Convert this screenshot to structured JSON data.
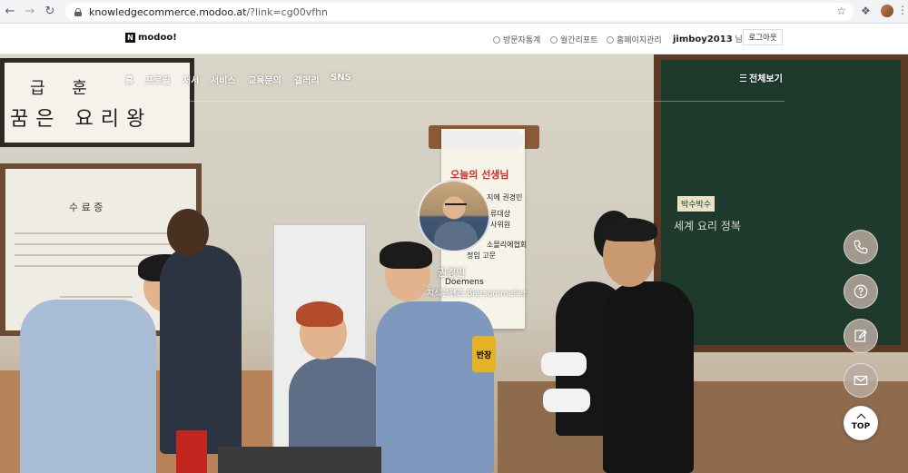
{
  "browser": {
    "url_domain": "knowledgecommerce.modoo.at",
    "url_path": "/?link=cg00vfhn"
  },
  "header": {
    "logo_mark": "N",
    "logo_text": "modoo!",
    "visitor_stats": "방문자통계",
    "monthly_report": "월간리포트",
    "homepage_admin": "홈페이지관리",
    "username": "jimboy2013",
    "user_suffix": " 님",
    "logout": "로그아웃"
  },
  "gnb": {
    "items": [
      "홈",
      "프로필",
      "저서",
      "서비스",
      "교육문의",
      "갤러리",
      "SNS"
    ],
    "all_view": "전체보기"
  },
  "hero": {
    "sign_line1": "급 훈",
    "sign_line2": "꿈은 요리왕",
    "certificate_title": "수 료 증",
    "scroll_title": "오늘의 선생님",
    "scroll_lines": [
      "지에 권경민",
      "류대상",
      "사위원",
      "소믈리에협회",
      "정입 고문"
    ],
    "blackboard_label": "박수박수",
    "blackboard_text": "세계 요리 정복",
    "apron_badge": "반장"
  },
  "profile": {
    "name": "권경민",
    "brand": "Doemens",
    "subtitle": "지식콘텐츠 Biersommelier"
  },
  "quick_menu": {
    "icons": [
      "phone-icon",
      "question-icon",
      "edit-icon",
      "mail-icon"
    ],
    "top_label": "TOP"
  }
}
